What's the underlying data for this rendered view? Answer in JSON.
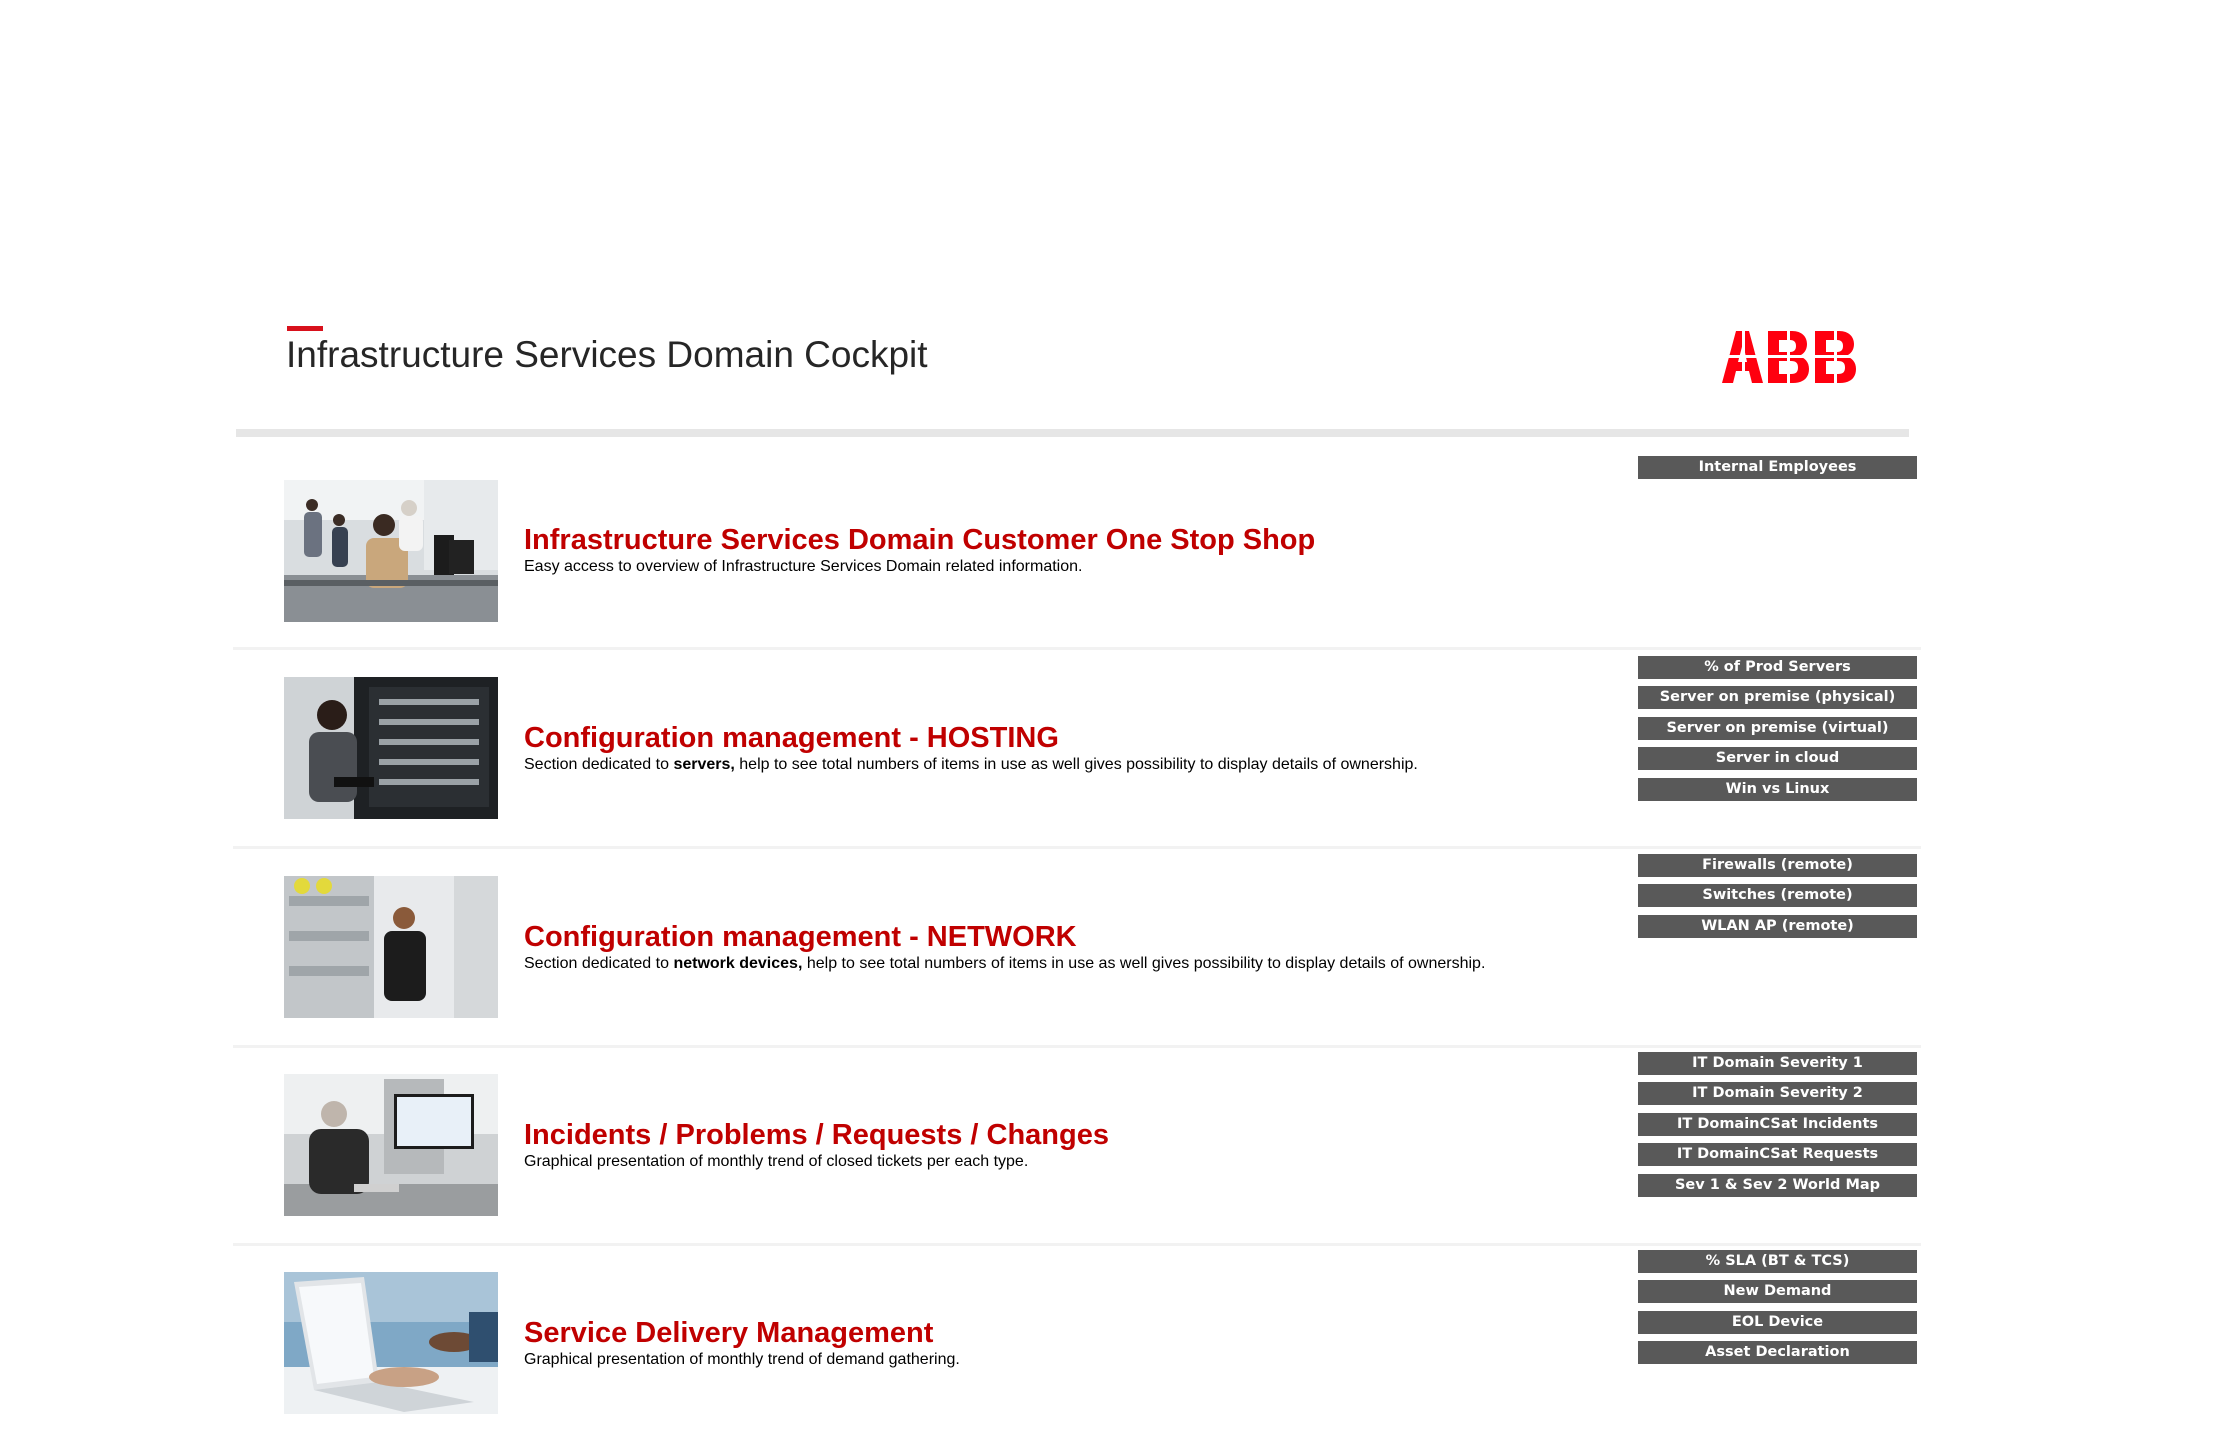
{
  "header": {
    "title": "Infrastructure Services Domain Cockpit",
    "logo_text": "ABB",
    "brand_color": "#ff000f"
  },
  "colors": {
    "accent_red": "#c00000",
    "button_bg": "#595959",
    "button_text": "#ffffff"
  },
  "sections": [
    {
      "title": "Infrastructure Services Domain Customer One Stop Shop",
      "description": "Easy access to overview of Infrastructure Services Domain related information.",
      "image": "office-team-photo",
      "buttons": [
        "Internal Employees"
      ]
    },
    {
      "title": "Configuration management - HOSTING",
      "description_pre": "Section dedicated to ",
      "description_bold": "servers,",
      "description_post": " help to see total numbers of items in use as well gives possibility to display details of ownership.",
      "image": "server-room-photo",
      "buttons": [
        "% of Prod Servers",
        "Server on premise (physical)",
        "Server on premise (virtual)",
        "Server in cloud",
        "Win vs Linux"
      ]
    },
    {
      "title": "Configuration management - NETWORK",
      "description_pre": "Section dedicated to ",
      "description_bold": "network devices,",
      "description_post": " help to see total numbers of items in use as well gives possibility to display details of ownership.",
      "image": "network-cabinet-photo",
      "buttons": [
        "Firewalls (remote)",
        "Switches (remote)",
        "WLAN AP (remote)"
      ]
    },
    {
      "title": "Incidents / Problems / Requests / Changes",
      "description": "Graphical presentation of monthly trend of closed tickets per each type.",
      "image": "service-desk-photo",
      "buttons": [
        "IT Domain Severity 1",
        "IT Domain Severity 2",
        "IT DomainCSat Incidents",
        "IT DomainCSat Requests",
        "Sev 1 & Sev 2 World Map"
      ]
    },
    {
      "title": "Service Delivery Management",
      "description": "Graphical presentation of monthly trend of demand gathering.",
      "image": "laptop-work-photo",
      "buttons": [
        "% SLA (BT & TCS)",
        "New Demand",
        "EOL Device",
        "Asset Declaration"
      ]
    }
  ]
}
